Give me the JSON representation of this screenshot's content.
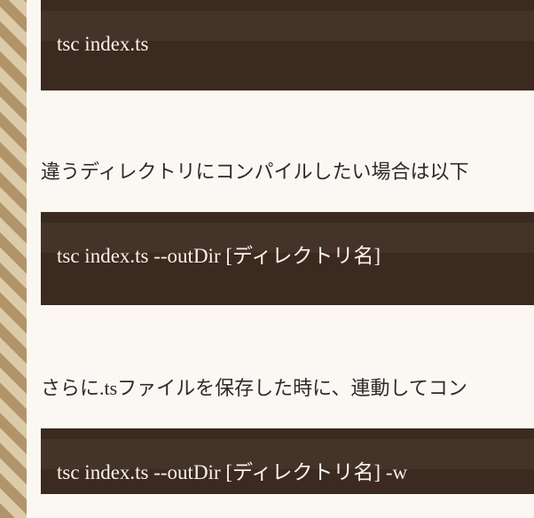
{
  "rail": {
    "decorative": true
  },
  "code1": {
    "text": "tsc index.ts"
  },
  "para1": {
    "text": "違うディレクトリにコンパイルしたい場合は以下"
  },
  "code2": {
    "text": "tsc index.ts --outDir [ディレクトリ名]"
  },
  "para2": {
    "text": "さらに.tsファイルを保存した時に、連動してコン"
  },
  "code3": {
    "text": "tsc index.ts --outDir [ディレクトリ名] -w"
  }
}
